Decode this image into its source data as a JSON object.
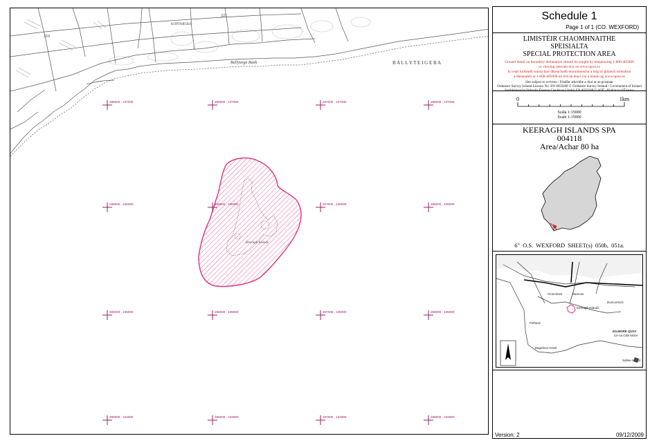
{
  "map": {
    "grid_labels": [
      [
        "285000 , 107000",
        "286000 , 107000",
        "287000 , 107000",
        "288000 , 107000"
      ],
      [
        "285000 , 106000",
        "286000 , 106000",
        "287000 , 106000",
        "288000 , 106000"
      ],
      [
        "285000 , 105000",
        "286000 , 105000",
        "287000 , 105000",
        "288000 , 105000"
      ],
      [
        "285000 , 104000",
        "286000 , 104000",
        "287000 , 104000",
        "288000 , 104000"
      ]
    ],
    "place_labels": {
      "ballyteige": "B A L L Y T E I G E    B A",
      "ballyteige_burrow": "Ballyteige Bank",
      "island_name": "Keeragh Islands",
      "goldcrook": "KOPTARCKS",
      "spot_221": "221",
      "spot_210": "210"
    },
    "colors": {
      "boundary": "#e0307a",
      "grid": "#9b1b62",
      "topo": "#555555"
    }
  },
  "panel": {
    "title": "Schedule 1",
    "page_info": "Page 1 of 1 (CO. WEXFORD)",
    "designation_irish_1": "LIMISTÉIR CHAOMHNAITHE",
    "designation_irish_2": "SPEISIALTA",
    "designation_english": "SPECIAL PROTECTION AREA",
    "notice_red_1": "Greater detail on boundary delineation should be sought by telephoning 1-800-405000",
    "notice_red_2": "or viewing relevant text on www.npws.ie",
    "notice_red_3": "Is ceart tuilleadh sonraí faoi dhreachadh teorainneacha a lorg trí ghlaoch teileafóin",
    "notice_red_4": "a dhéanamh ar 1-800-405000 nó tríd an téacs cuí a léamh ag www.npws.ie",
    "notice_small_1": "Site subject to revision / Féadfar athruithe a chur ar an gceantar",
    "notice_small_2": "Ordnance Survey Ireland Licence No. EN 0059208 © Ordnance Survey Ireland / Government of Ireland",
    "notice_small_3": "Suirbhéireacht Ordanáis Éireann Ceadúnas Uimhir EN 0059208 © SOÉ / Rialtas na hÉireann",
    "scale_zero": "0",
    "scale_km": "1km",
    "scale_irish": "Scála 1:15000",
    "scale_english": "Scale 1:15000",
    "site_name": "KEERAGH ISLANDS SPA",
    "site_code": "004118",
    "site_area": "Area/Achar 80 ha",
    "sheet_info": "6\" O.S.  WEXFORD   SHEET(s) 050b, 051a.",
    "version": "Version: 2",
    "date": "09/12/2009",
    "locator_labels": {
      "keeragh": "Keeragh Islands",
      "kilmore_quay": "KILMORE QUAY",
      "kilmore_irish": "Cé na Cille Móire",
      "saltee": "Saltee Island",
      "baginbun": "Baginbun Head",
      "fethard": "Fethard",
      "clonmines": "Clonmines",
      "duncormick": "Duncormick",
      "bannow": "Bannow"
    }
  }
}
